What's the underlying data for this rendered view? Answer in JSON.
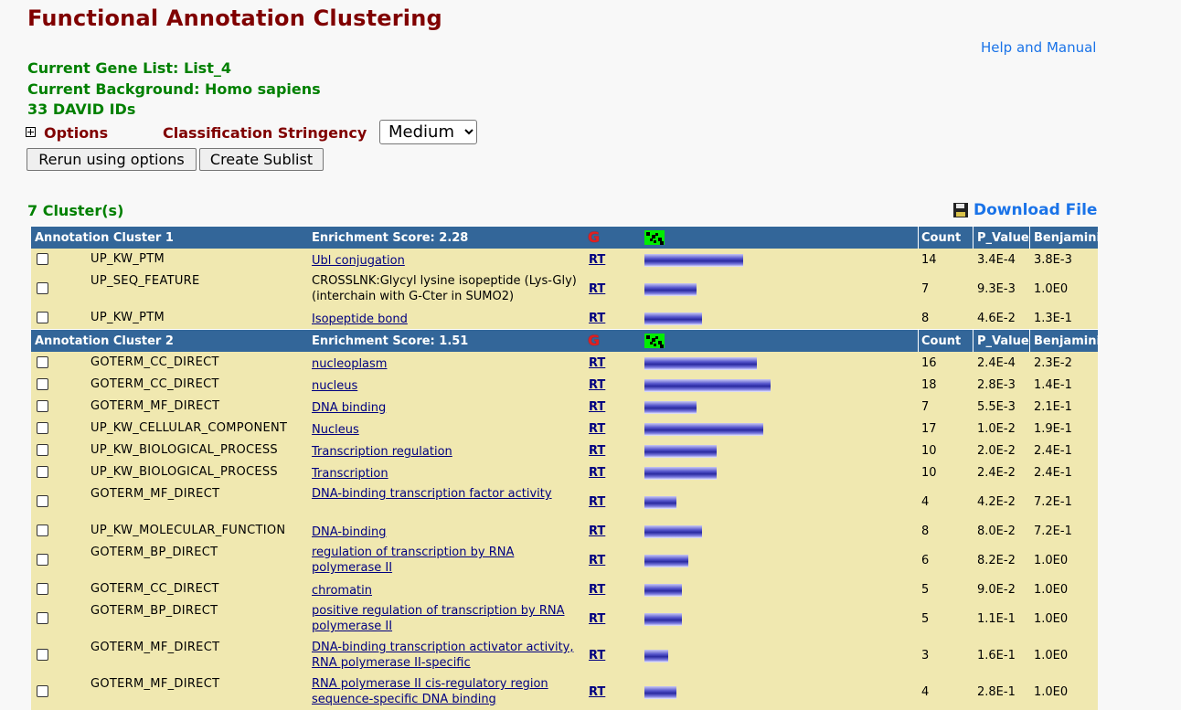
{
  "title": "Functional Annotation Clustering",
  "help_link": "Help and Manual",
  "gene_list": "Current Gene List: List_4",
  "background": "Current Background: Homo sapiens",
  "id_count": "33 DAVID IDs",
  "options_label": "Options",
  "stringency_label": "Classification Stringency",
  "stringency_value": "Medium",
  "buttons": {
    "rerun": "Rerun using options",
    "sublist": "Create Sublist"
  },
  "cluster_count": "7 Cluster(s)",
  "download_label": "Download File",
  "icons": {
    "expand": "plus-box-icon",
    "download": "floppy-disk-icon",
    "graph": "g-graph-icon",
    "heatmap": "heatmap-icon"
  },
  "colors": {
    "title": "#800000",
    "info": "#008000",
    "header_bg": "#336699",
    "row_bg": "#f0e8b0",
    "link": "#000080",
    "bar": "#3a3ab0"
  },
  "column_headers": {
    "count": "Count",
    "p_value": "P_Value",
    "benjamini": "Benjamini"
  },
  "rt_label": "RT",
  "clusters": [
    {
      "name": "Annotation Cluster 1",
      "score": "Enrichment Score: 2.28",
      "rows": [
        {
          "category": "UP_KW_PTM",
          "term": "Ubl conjugation",
          "count": "14",
          "p_value": "3.4E-4",
          "benjamini": "3.8E-3",
          "bar": 0.78
        },
        {
          "category": "UP_SEQ_FEATURE",
          "term": "CROSSLNK:Glycyl lysine isopeptide (Lys-Gly) (interchain with G-Cter in SUMO2)",
          "count": "7",
          "p_value": "9.3E-3",
          "benjamini": "1.0E0",
          "bar": 0.41,
          "plain": true
        },
        {
          "category": "UP_KW_PTM",
          "term": "Isopeptide bond",
          "count": "8",
          "p_value": "4.6E-2",
          "benjamini": "1.3E-1",
          "bar": 0.46
        }
      ]
    },
    {
      "name": "Annotation Cluster 2",
      "score": "Enrichment Score: 1.51",
      "rows": [
        {
          "category": "GOTERM_CC_DIRECT",
          "term": "nucleoplasm",
          "count": "16",
          "p_value": "2.4E-4",
          "benjamini": "2.3E-2",
          "bar": 0.89
        },
        {
          "category": "GOTERM_CC_DIRECT",
          "term": "nucleus",
          "count": "18",
          "p_value": "2.8E-3",
          "benjamini": "1.4E-1",
          "bar": 1.0
        },
        {
          "category": "GOTERM_MF_DIRECT",
          "term": "DNA binding",
          "count": "7",
          "p_value": "5.5E-3",
          "benjamini": "2.1E-1",
          "bar": 0.41
        },
        {
          "category": "UP_KW_CELLULAR_COMPONENT",
          "term": "Nucleus",
          "count": "17",
          "p_value": "1.0E-2",
          "benjamini": "1.9E-1",
          "bar": 0.94
        },
        {
          "category": "UP_KW_BIOLOGICAL_PROCESS",
          "term": "Transcription regulation",
          "count": "10",
          "p_value": "2.0E-2",
          "benjamini": "2.4E-1",
          "bar": 0.57
        },
        {
          "category": "UP_KW_BIOLOGICAL_PROCESS",
          "term": "Transcription",
          "count": "10",
          "p_value": "2.4E-2",
          "benjamini": "2.4E-1",
          "bar": 0.57
        },
        {
          "category": "GOTERM_MF_DIRECT",
          "term": "DNA-binding transcription factor activity",
          "count": "4",
          "p_value": "4.2E-2",
          "benjamini": "7.2E-1",
          "bar": 0.25
        },
        {
          "category": "UP_KW_MOLECULAR_FUNCTION",
          "term": "DNA-binding",
          "count": "8",
          "p_value": "8.0E-2",
          "benjamini": "7.2E-1",
          "bar": 0.46
        },
        {
          "category": "GOTERM_BP_DIRECT",
          "term": "regulation of transcription by RNA polymerase II",
          "count": "6",
          "p_value": "8.2E-2",
          "benjamini": "1.0E0",
          "bar": 0.35
        },
        {
          "category": "GOTERM_CC_DIRECT",
          "term": "chromatin",
          "count": "5",
          "p_value": "9.0E-2",
          "benjamini": "1.0E0",
          "bar": 0.3
        },
        {
          "category": "GOTERM_BP_DIRECT",
          "term": "positive regulation of transcription by RNA polymerase II",
          "count": "5",
          "p_value": "1.1E-1",
          "benjamini": "1.0E0",
          "bar": 0.3
        },
        {
          "category": "GOTERM_MF_DIRECT",
          "term": "DNA-binding transcription activator activity, RNA polymerase II-specific",
          "count": "3",
          "p_value": "1.6E-1",
          "benjamini": "1.0E0",
          "bar": 0.19
        },
        {
          "category": "GOTERM_MF_DIRECT",
          "term": "RNA polymerase II cis-regulatory region sequence-specific DNA binding",
          "count": "4",
          "p_value": "2.8E-1",
          "benjamini": "1.0E0",
          "bar": 0.25
        }
      ]
    }
  ]
}
